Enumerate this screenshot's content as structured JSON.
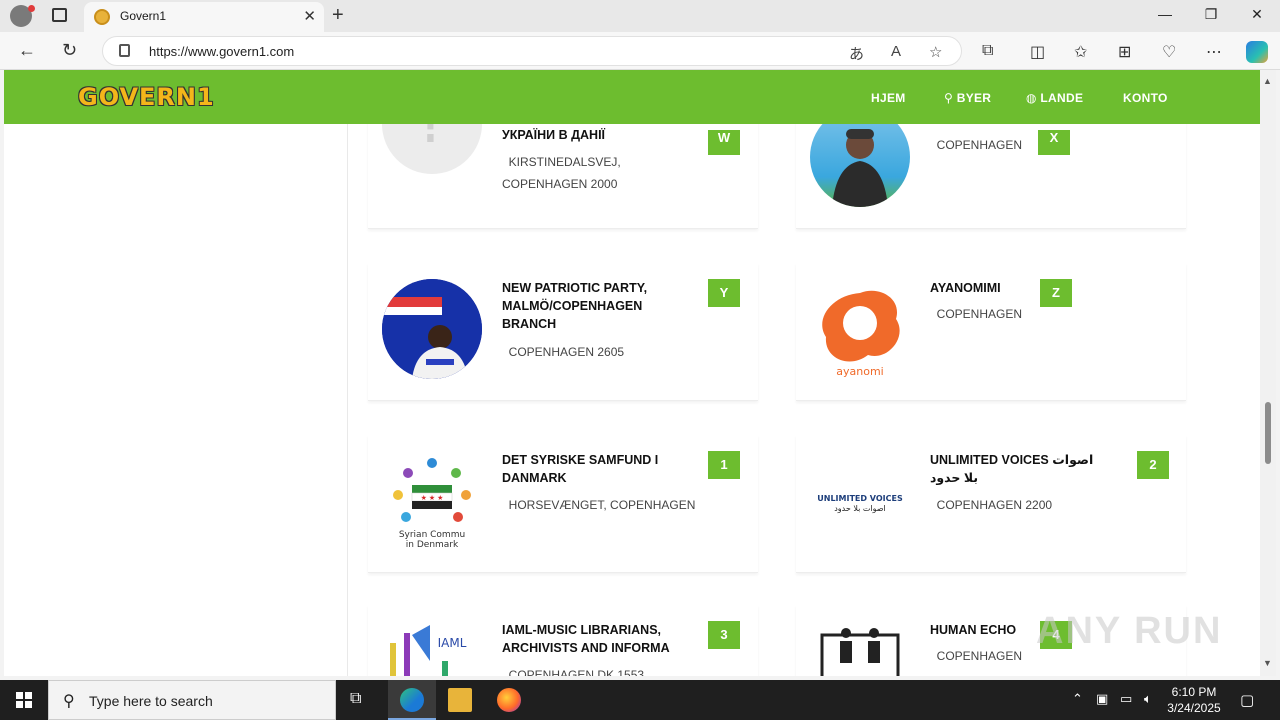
{
  "browser": {
    "tab_title": "Govern1",
    "url": "https://www.govern1.com",
    "new_tab": "+",
    "close_tab": "✕",
    "win_min": "—",
    "win_max": "❐",
    "win_close": "✕"
  },
  "site": {
    "logo": "GOVERN1",
    "menu": {
      "home": "HJEM",
      "cities": "BYER",
      "countries": "LANDE",
      "account": "KONTO"
    }
  },
  "cards": [
    {
      "name": "УКРАЇНИ В ДАНІЇ",
      "address": "KIRSTINEDALSVEJ,",
      "address2": "COPENHAGEN 2000",
      "badge": "W"
    },
    {
      "name": "",
      "address": "COPENHAGEN",
      "address2": "",
      "badge": "X"
    },
    {
      "name": "NEW PATRIOTIC PARTY, MALMÖ/COPENHAGEN BRANCH",
      "address": "COPENHAGEN 2605",
      "address2": "",
      "badge": "Y"
    },
    {
      "name": "AYANOMIMI",
      "address": "COPENHAGEN",
      "address2": "",
      "badge": "Z",
      "logo_text": "ayanomi"
    },
    {
      "name": "DET SYRISKE SAMFUND I DANMARK",
      "address": "HORSEVÆNGET, COPENHAGEN",
      "address2": "",
      "badge": "1",
      "logo_text": "Syrian Commu",
      "logo_text2": "in Denmark"
    },
    {
      "name": "UNLIMITED VOICES اصوات بلا حدود",
      "address": "COPENHAGEN 2200",
      "address2": "",
      "badge": "2",
      "logo_text": "UNLIMITED VOICES",
      "logo_text2": "اصوات بلا حدود"
    },
    {
      "name": "IAML-MUSIC LIBRARIANS, ARCHIVISTS AND INFORMA",
      "address": "COPENHAGEN DK 1553",
      "address2": "",
      "badge": "3",
      "logo_text": "IAML"
    },
    {
      "name": "HUMAN ECHO",
      "address": "COPENHAGEN",
      "address2": "",
      "badge": "4"
    }
  ],
  "taskbar": {
    "search_placeholder": "Type here to search",
    "time": "6:10 PM",
    "date": "3/24/2025"
  },
  "watermark": "ANY RUN",
  "colors": {
    "brand_green": "#6dbd2f",
    "logo_gold": "#f4b61a"
  }
}
